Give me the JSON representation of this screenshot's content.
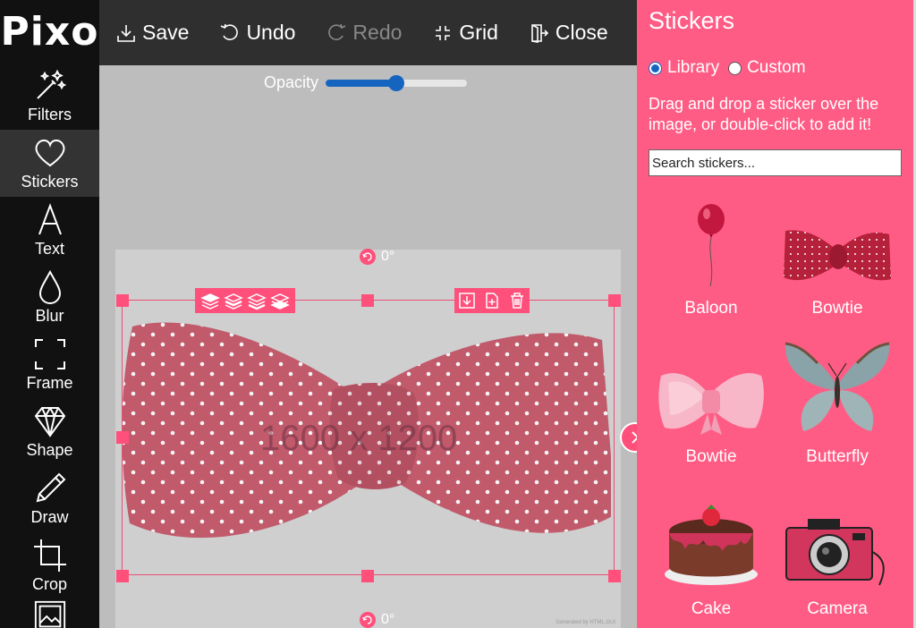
{
  "app": {
    "logo": "Pixo"
  },
  "sidebar": {
    "items": [
      {
        "label": "Filters",
        "icon": "magic-wand-icon"
      },
      {
        "label": "Stickers",
        "icon": "heart-icon"
      },
      {
        "label": "Text",
        "icon": "text-a-icon"
      },
      {
        "label": "Blur",
        "icon": "droplet-icon"
      },
      {
        "label": "Frame",
        "icon": "frame-corners-icon"
      },
      {
        "label": "Shape",
        "icon": "diamond-icon"
      },
      {
        "label": "Draw",
        "icon": "pencil-icon"
      },
      {
        "label": "Crop",
        "icon": "crop-icon"
      }
    ],
    "active": "Stickers"
  },
  "toolbar": {
    "save_label": "Save",
    "undo_label": "Undo",
    "redo_label": "Redo",
    "grid_label": "Grid",
    "close_label": "Close"
  },
  "canvas": {
    "opacity_label": "Opacity",
    "opacity_value": 0.5,
    "size_text": "1600 x 1200",
    "rotation_top": "0°",
    "rotation_bottom": "0°",
    "credit": "Generated by HTML.GUI"
  },
  "panel": {
    "title": "Stickers",
    "source_options": [
      "Library",
      "Custom"
    ],
    "selected_source": "Library",
    "instructions": "Drag and drop a sticker over the image, or double-click to add it!",
    "search_placeholder": "Search stickers...",
    "stickers": [
      {
        "label": "Baloon"
      },
      {
        "label": "Bowtie"
      },
      {
        "label": "Bowtie"
      },
      {
        "label": "Butterfly"
      },
      {
        "label": "Cake"
      },
      {
        "label": "Camera"
      }
    ]
  },
  "colors": {
    "accent": "#ff5c85",
    "handle": "#ff4f7b",
    "sidebar": "#111111",
    "toolbar": "#2f2f2f",
    "slider": "#1565c0"
  }
}
